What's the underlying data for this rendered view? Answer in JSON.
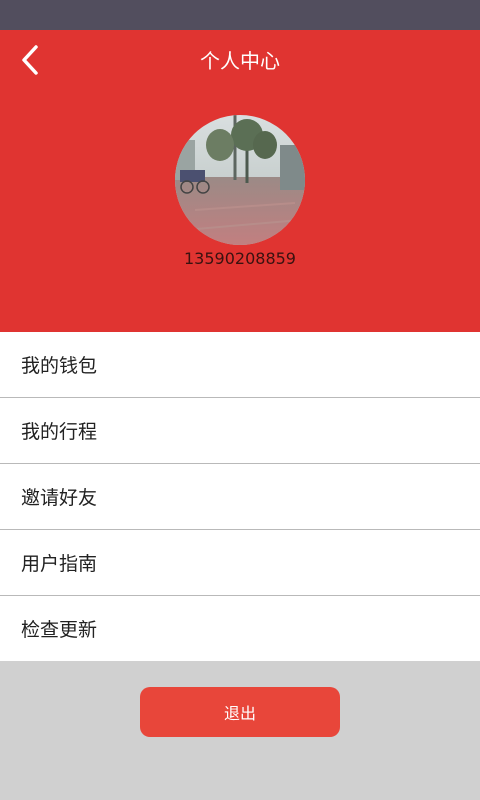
{
  "colors": {
    "status_bar": "#524e5e",
    "header_bg": "#e03431",
    "logout_button": "#e8463a",
    "page_bg": "#d0d0d0"
  },
  "header": {
    "back_icon": "chevron-left-icon",
    "title": "个人中心",
    "avatar_icon": "user-photo",
    "phone": "13590208859"
  },
  "menu": {
    "items": [
      {
        "label": "我的钱包"
      },
      {
        "label": "我的行程"
      },
      {
        "label": "邀请好友"
      },
      {
        "label": "用户指南"
      },
      {
        "label": "检查更新"
      }
    ]
  },
  "footer": {
    "logout_label": "退出"
  }
}
